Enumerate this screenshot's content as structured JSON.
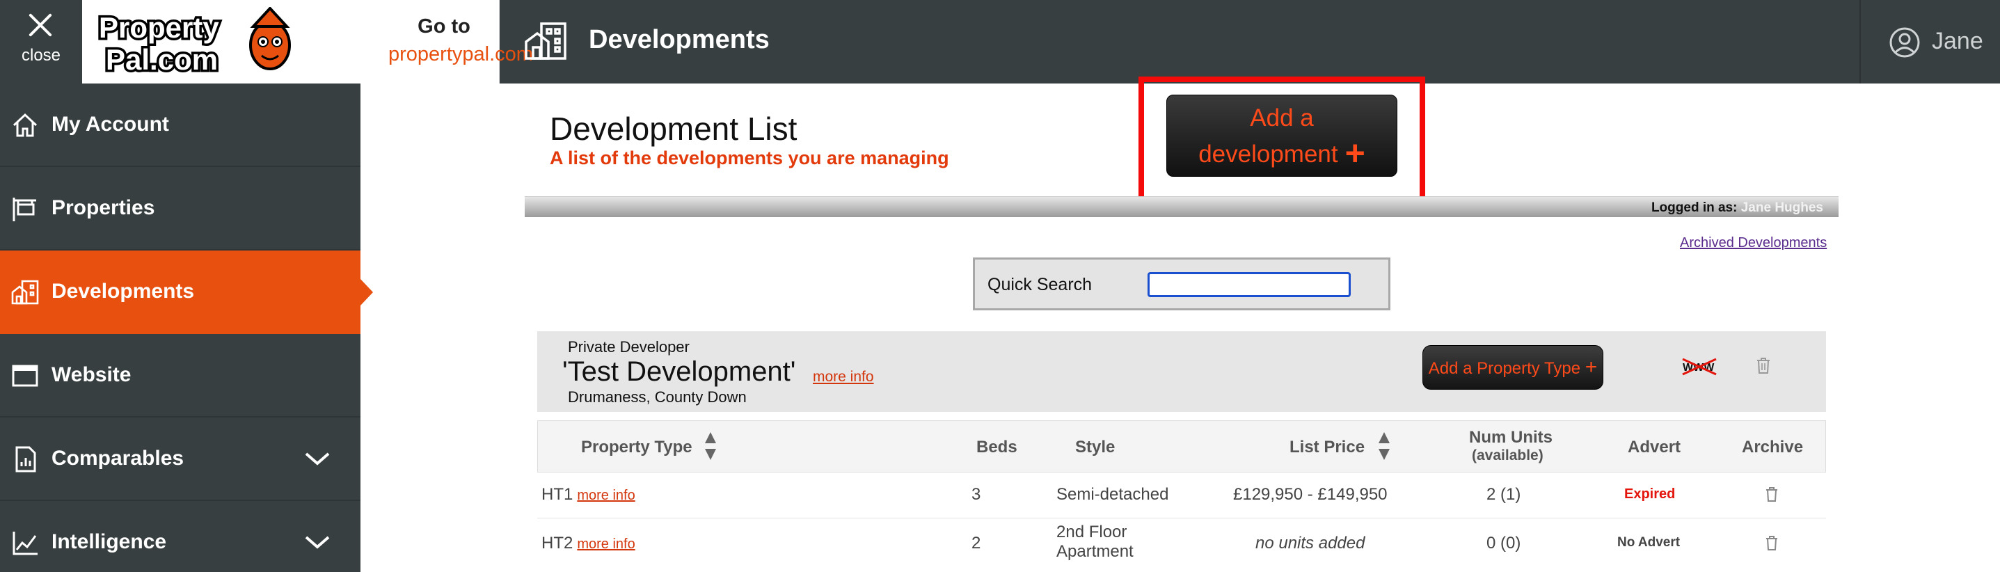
{
  "topbar": {
    "close_label": "close",
    "goto_label": "Go to",
    "goto_link": "propertypal.com",
    "page_title": "Developments",
    "user_name": "Jane"
  },
  "logo": {
    "line1": "Property",
    "line2": "Pal.com"
  },
  "sidebar": {
    "items": [
      {
        "label": "My Account",
        "icon": "home-icon"
      },
      {
        "label": "Properties",
        "icon": "sign-icon"
      },
      {
        "label": "Developments",
        "icon": "buildings-icon",
        "active": true
      },
      {
        "label": "Website",
        "icon": "browser-window-icon"
      },
      {
        "label": "Comparables",
        "icon": "document-chart-icon"
      },
      {
        "label": "Intelligence",
        "icon": "line-chart-icon"
      }
    ]
  },
  "main": {
    "title": "Development List",
    "subtitle": "A list of the developments you are managing",
    "add_development_line1": "Add a",
    "add_development_line2": "development",
    "add_development_plus": "+",
    "logged_in_label": "Logged in as:",
    "logged_in_name": "Jane Hughes",
    "archived_link": "Archived Developments",
    "quick_search_label": "Quick Search",
    "quick_search_value": ""
  },
  "development": {
    "type": "Private Developer",
    "name": "'Test Development'",
    "more_info": "more info",
    "location": "Drumaness, County Down",
    "add_property_type": "Add a Property Type",
    "add_property_type_plus": "+",
    "www_label": "WWW"
  },
  "table": {
    "headers": {
      "property_type": "Property Type",
      "beds": "Beds",
      "style": "Style",
      "list_price": "List Price",
      "num_units": "Num Units",
      "num_units_sub": "(available)",
      "advert": "Advert",
      "archive": "Archive"
    },
    "rows": [
      {
        "type": "HT1",
        "more": "more info",
        "beds": "3",
        "style_line1": "Semi-detached",
        "style_line2": "",
        "price": "£129,950 - £149,950",
        "units": "2 (1)",
        "advert": "Expired"
      },
      {
        "type": "HT2",
        "more": "more info",
        "beds": "2",
        "style_line1": "2nd Floor",
        "style_line2": "Apartment",
        "price": "no units added",
        "units": "0 (0)",
        "advert": "No Advert"
      }
    ]
  },
  "colors": {
    "sidebar_bg": "#373f40",
    "accent": "#e8500f",
    "highlight_box": "#f50a0a"
  }
}
